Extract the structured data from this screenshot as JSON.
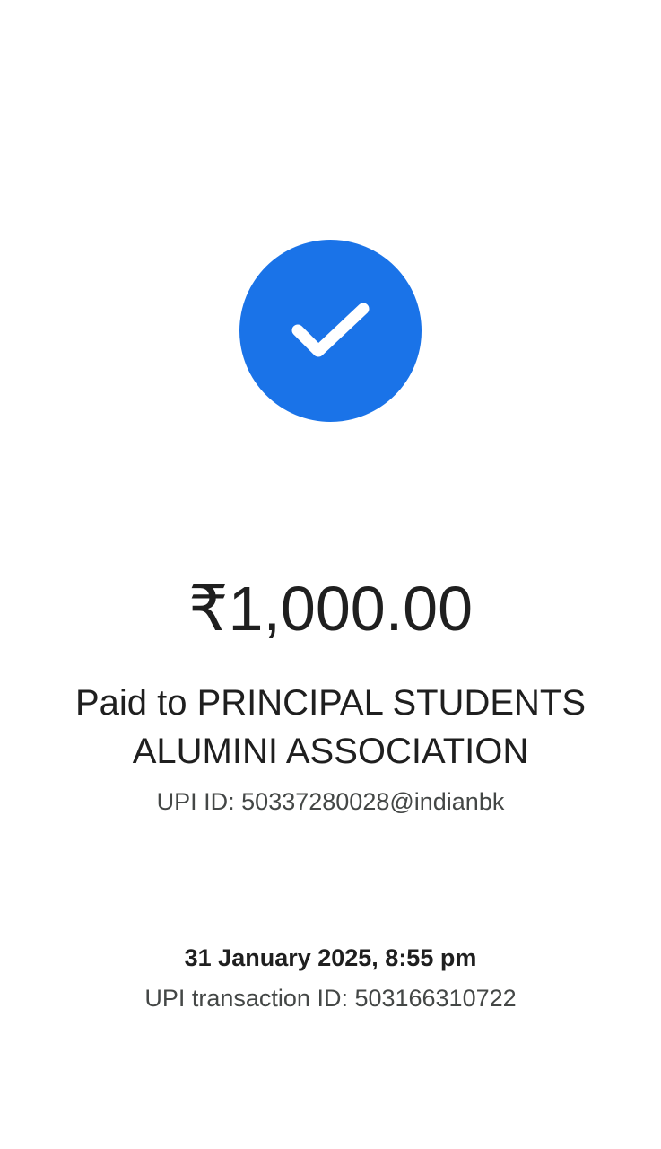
{
  "status": {
    "icon": "check-icon",
    "circle_color": "#1a73e8"
  },
  "payment": {
    "amount": "₹1,000.00",
    "paid_to_line1": "Paid to PRINCIPAL STUDENTS",
    "paid_to_line2": "ALUMINI ASSOCIATION",
    "upi_id": "UPI ID: 50337280028@indianbk"
  },
  "transaction": {
    "datetime": "31 January 2025, 8:55 pm",
    "id": "UPI transaction ID: 503166310722"
  }
}
